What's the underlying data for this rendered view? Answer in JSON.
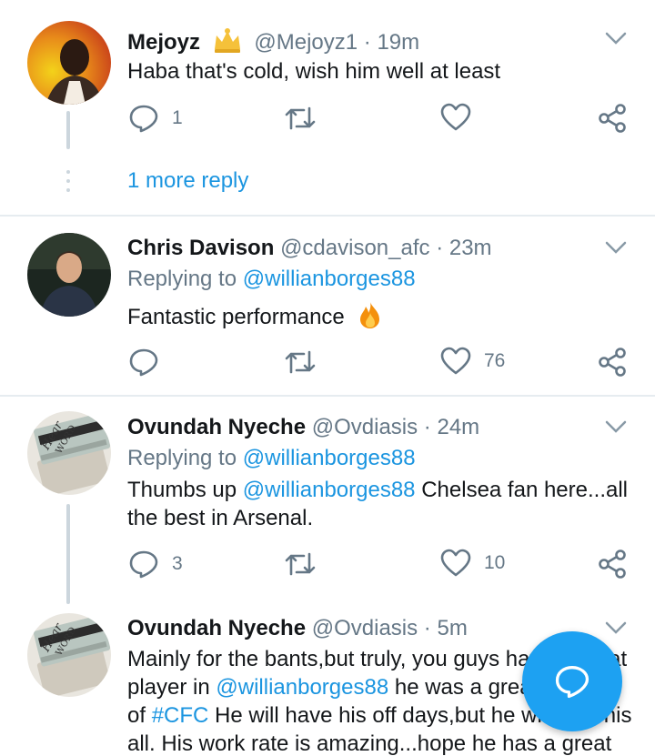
{
  "tweets": [
    {
      "name": "Mejoyz",
      "handle": "@Mejoyz1",
      "separator": "·",
      "time": "19m",
      "text": "Haba that's cold, wish him well at least",
      "reply_count": "1",
      "retweet_count": "",
      "like_count": ""
    },
    {
      "name": "Chris Davison",
      "handle": "@cdavison_afc",
      "separator": "·",
      "time": "23m",
      "replying_prefix": "Replying to",
      "replying_to": "@willianborges88",
      "text": "Fantastic performance",
      "emoji": "fire",
      "reply_count": "",
      "retweet_count": "",
      "like_count": "76"
    },
    {
      "name": "Ovundah Nyeche",
      "handle": "@Ovdiasis",
      "separator": "·",
      "time": "24m",
      "replying_prefix": "Replying to",
      "replying_to": "@willianborges88",
      "text_prefix": "Thumbs up",
      "text_mention": "@willianborges88",
      "text_suffix": " Chelsea fan here...all the best in Arsenal.",
      "reply_count": "3",
      "retweet_count": "",
      "like_count": "10"
    },
    {
      "name": "Ovundah Nyeche",
      "handle": "@Ovdiasis",
      "separator": "·",
      "time": "5m",
      "line1": "Mainly for the bants,but truly, you guys have a great",
      "line2_prefix": "player in",
      "line2_mention": "@willianborges88",
      "line2_suffix": " he was a great part",
      "line3_prefix": "of",
      "line3_hashtag": "#CFC",
      "line3_suffix": " He will have his off days,but he will give his",
      "line4": "all. His work rate is amazing...hope he has a great"
    }
  ],
  "more_replies": "1 more reply",
  "icons": {
    "reply": "reply-icon",
    "retweet": "retweet-icon",
    "like": "heart-icon",
    "share": "share-icon",
    "menu": "chevron-down-icon",
    "badge": "crown-emoji-icon",
    "fire": "fire-emoji-icon",
    "compose": "compose-reply-icon"
  },
  "colors": {
    "accent": "#1da1f2",
    "link": "#1b95e0",
    "secondary_text": "#657786",
    "divider": "#e6ecf0",
    "thread_line": "#ccd6dd"
  }
}
